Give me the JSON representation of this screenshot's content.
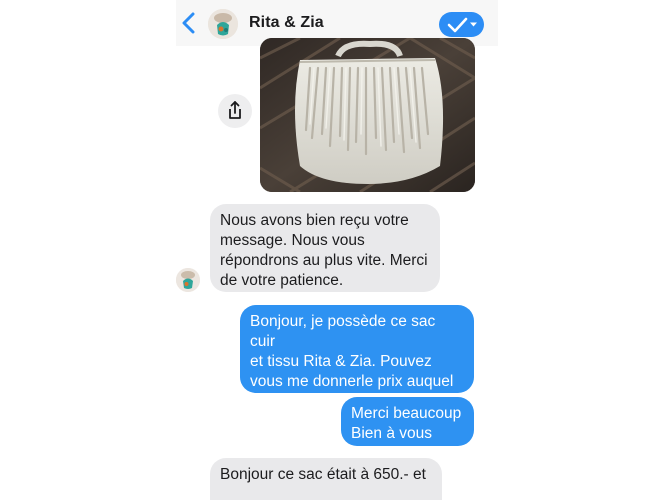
{
  "header": {
    "title": "Rita & Zia",
    "back_icon": "chevron-left-icon",
    "action_icon": "checkmark-dropdown-icon",
    "accent_color": "#2c8df5"
  },
  "messages": [
    {
      "direction": "incoming",
      "type": "image",
      "image_subject": "white leather bag with fringe on wicker chair"
    },
    {
      "direction": "incoming",
      "type": "text",
      "text": "Nous avons bien reçu votre\nmessage. Nous vous\nrépondrons au plus vite. Merci\nde votre patience."
    },
    {
      "direction": "outgoing",
      "type": "text",
      "text": "Bonjour, je possède ce sac cuir\net tissu Rita & Zia. Pouvez\nvous me donnerle prix auquel il\nétait vendu?"
    },
    {
      "direction": "outgoing",
      "type": "text",
      "text": "Merci beaucoup\nBien à vous"
    },
    {
      "direction": "incoming",
      "type": "text",
      "text": "Bonjour ce sac était à 650.-  et\n"
    }
  ],
  "colors": {
    "incoming_bubble": "#e9e9eb",
    "outgoing_bubble": "#2e92f2"
  }
}
